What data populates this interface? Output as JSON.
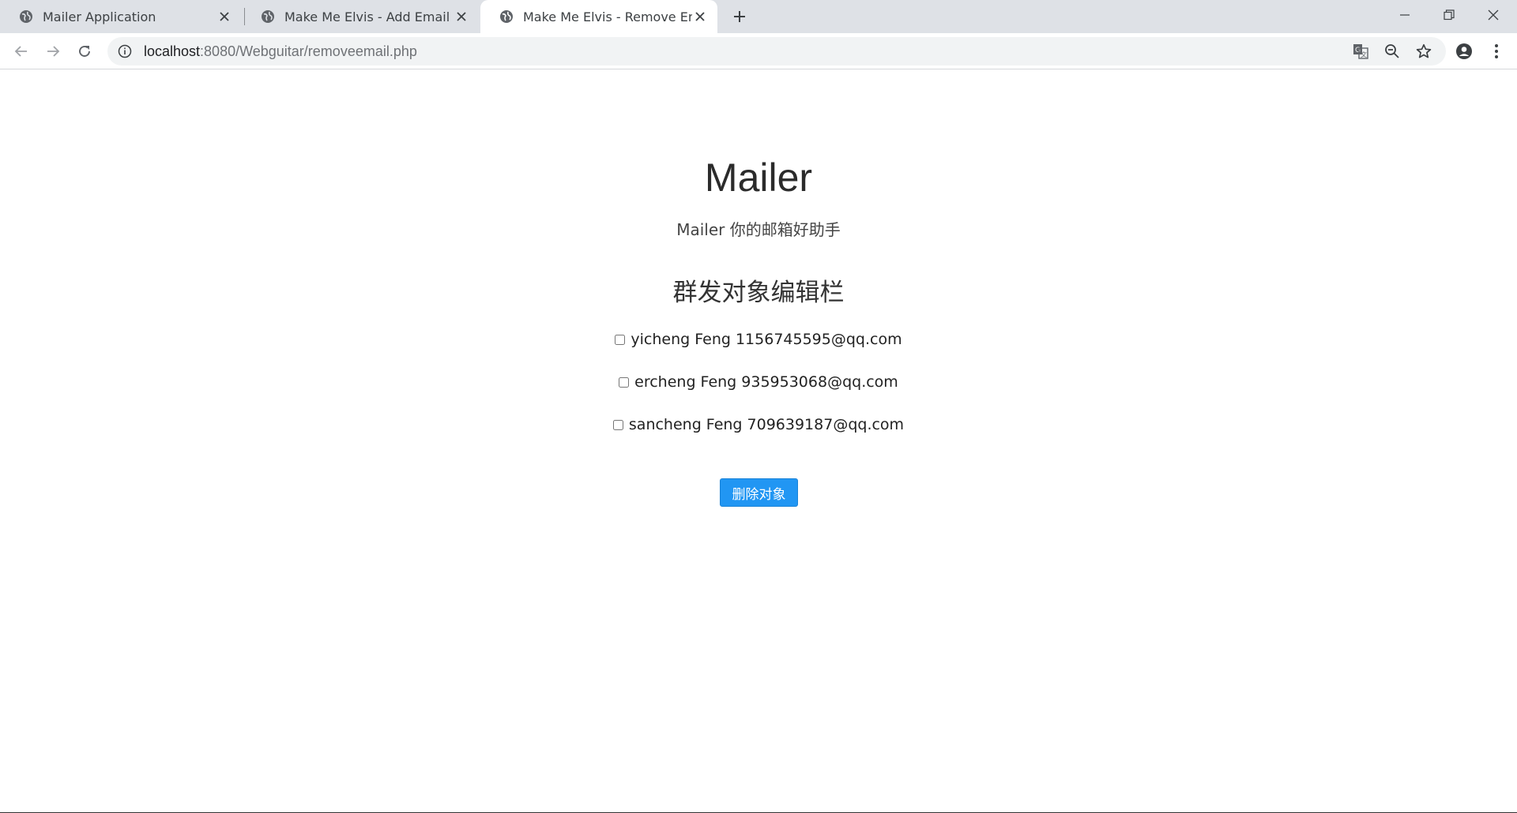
{
  "browser": {
    "tabs": [
      {
        "title": "Mailer Application",
        "active": false
      },
      {
        "title": "Make Me Elvis - Add Email",
        "active": false
      },
      {
        "title": "Make Me Elvis - Remove Email",
        "active": true
      }
    ],
    "address": {
      "host": "localhost",
      "rest": ":8080/Webguitar/removeemail.php"
    }
  },
  "page": {
    "title": "Mailer",
    "subtitle": "Mailer 你的邮箱好助手",
    "section_title": "群发对象编辑栏",
    "emails": [
      {
        "label": "yicheng Feng 1156745595@qq.com",
        "checked": false
      },
      {
        "label": "ercheng Feng 935953068@qq.com",
        "checked": false
      },
      {
        "label": "sancheng Feng 709639187@qq.com",
        "checked": false
      }
    ],
    "remove_button": "删除对象"
  },
  "colors": {
    "button": "#2196f3",
    "tabstrip": "#dee1e6"
  }
}
